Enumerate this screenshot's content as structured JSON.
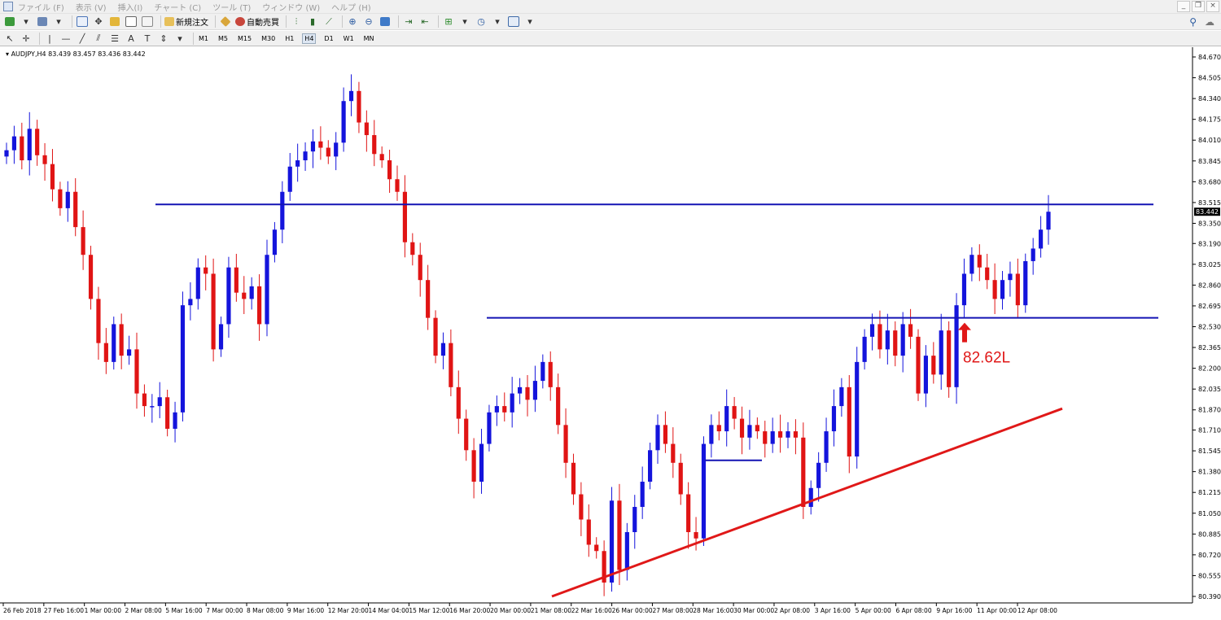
{
  "menubar": {
    "items": [
      "ファイル (F)",
      "表示 (V)",
      "挿入(I)",
      "チャート (C)",
      "ツール (T)",
      "ウィンドウ (W)",
      "ヘルプ (H)"
    ]
  },
  "toolbar1": {
    "new_order_label": "新規注文",
    "auto_trade_label": "自動売買"
  },
  "toolbar2": {
    "timeframes": [
      "M1",
      "M5",
      "M15",
      "M30",
      "H1",
      "H4",
      "D1",
      "W1",
      "MN"
    ],
    "active_timeframe": "H4"
  },
  "chart": {
    "header": "AUDJPY,H4  83.439 83.457 83.436 83.442",
    "current_price": "83.442",
    "annotation_text": "82.62L",
    "colors": {
      "bull": "#1414dc",
      "bear": "#e01414",
      "level": "#1414b4",
      "trend": "#e01818"
    }
  },
  "chart_data": {
    "type": "candlestick",
    "symbol": "AUDJPY",
    "timeframe": "H4",
    "ohlc_last": {
      "open": 83.439,
      "high": 83.457,
      "low": 83.436,
      "close": 83.442
    },
    "y_ticks": [
      "84.670",
      "84.505",
      "84.340",
      "84.175",
      "84.010",
      "83.845",
      "83.680",
      "83.515",
      "83.350",
      "83.190",
      "83.025",
      "82.860",
      "82.695",
      "82.530",
      "82.365",
      "82.200",
      "82.035",
      "81.870",
      "81.710",
      "81.545",
      "81.380",
      "81.215",
      "81.050",
      "80.885",
      "80.720",
      "80.555",
      "80.390"
    ],
    "ylim": [
      80.39,
      84.67
    ],
    "x_ticks": [
      "26 Feb 2018",
      "27 Feb 16:00",
      "1 Mar 00:00",
      "2 Mar 08:00",
      "5 Mar 16:00",
      "7 Mar 00:00",
      "8 Mar 08:00",
      "9 Mar 16:00",
      "12 Mar 20:00",
      "14 Mar 04:00",
      "15 Mar 12:00",
      "16 Mar 20:00",
      "20 Mar 00:00",
      "21 Mar 08:00",
      "22 Mar 16:00",
      "26 Mar 00:00",
      "27 Mar 08:00",
      "28 Mar 16:00",
      "30 Mar 00:00",
      "2 Apr 08:00",
      "3 Apr 16:00",
      "5 Apr 00:00",
      "6 Apr 08:00",
      "9 Apr 16:00",
      "11 Apr 00:00",
      "12 Apr 08:00"
    ],
    "closes": [
      83.93,
      84.04,
      83.85,
      84.1,
      83.89,
      83.82,
      83.62,
      83.47,
      83.6,
      83.32,
      83.1,
      82.75,
      82.4,
      82.25,
      82.55,
      82.3,
      82.35,
      82.0,
      81.9,
      81.9,
      81.97,
      81.72,
      81.85,
      82.7,
      82.75,
      83.0,
      82.95,
      82.35,
      82.55,
      83.0,
      82.8,
      82.75,
      82.85,
      82.55,
      83.1,
      83.3,
      83.6,
      83.8,
      83.85,
      83.92,
      84.0,
      83.95,
      83.88,
      83.99,
      84.32,
      84.4,
      84.15,
      84.05,
      83.9,
      83.85,
      83.7,
      83.6,
      83.2,
      83.1,
      82.9,
      82.6,
      82.3,
      82.4,
      82.05,
      81.8,
      81.55,
      81.3,
      81.6,
      81.85,
      81.9,
      81.85,
      82.0,
      82.05,
      81.95,
      82.1,
      82.25,
      82.05,
      81.75,
      81.45,
      81.2,
      81.0,
      80.8,
      80.75,
      80.5,
      81.15,
      80.6,
      80.9,
      81.1,
      81.3,
      81.55,
      81.75,
      81.6,
      81.45,
      81.2,
      80.9,
      80.85,
      81.6,
      81.75,
      81.7,
      81.9,
      81.8,
      81.65,
      81.75,
      81.7,
      81.6,
      81.7,
      81.65,
      81.7,
      81.65,
      81.1,
      81.25,
      81.45,
      81.7,
      81.9,
      82.05,
      81.5,
      82.25,
      82.45,
      82.55,
      82.35,
      82.5,
      82.3,
      82.55,
      82.45,
      82.0,
      82.3,
      82.15,
      82.5,
      82.05,
      82.7,
      82.95,
      83.1,
      83.0,
      82.9,
      82.75,
      82.9,
      82.95,
      82.7,
      83.05,
      83.15,
      83.3,
      83.442
    ],
    "levels": [
      83.5,
      82.6
    ],
    "trendline": [
      {
        "x": "22 Mar 08:00",
        "y": 80.39
      },
      {
        "x": "12 Apr 08:00",
        "y": 81.88
      }
    ],
    "annotation": {
      "text": "82.62L",
      "arrow": "up",
      "color": "#e01818"
    },
    "grid": false
  }
}
